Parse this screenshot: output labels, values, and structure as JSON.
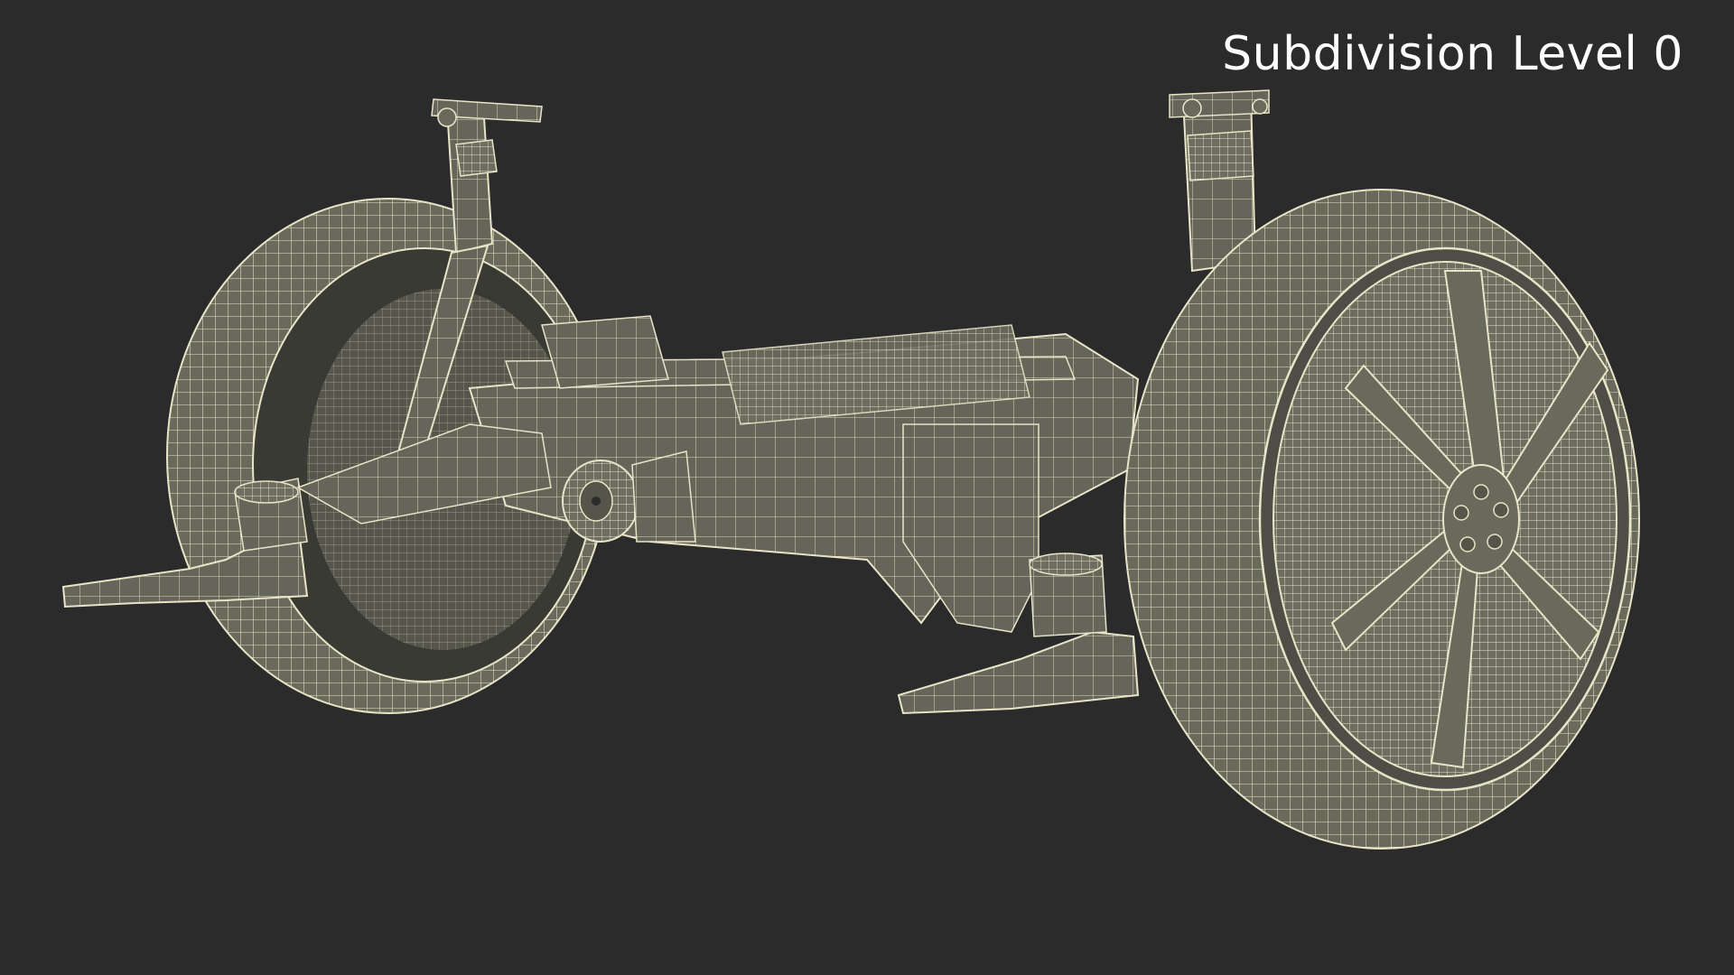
{
  "viewport": {
    "label": "Subdivision Level 0",
    "background_color": "#2b2b2b",
    "label_color": "#ffffff",
    "mesh_fill_color": "#6a6a5c",
    "mesh_line_color": "#e8e4c8"
  },
  "model": {
    "parts": [
      "left-wheel",
      "right-wheel",
      "left-shock-absorber",
      "right-shock-absorber",
      "axle-beam",
      "differential",
      "left-control-arm",
      "right-control-arm",
      "right-rim"
    ]
  }
}
